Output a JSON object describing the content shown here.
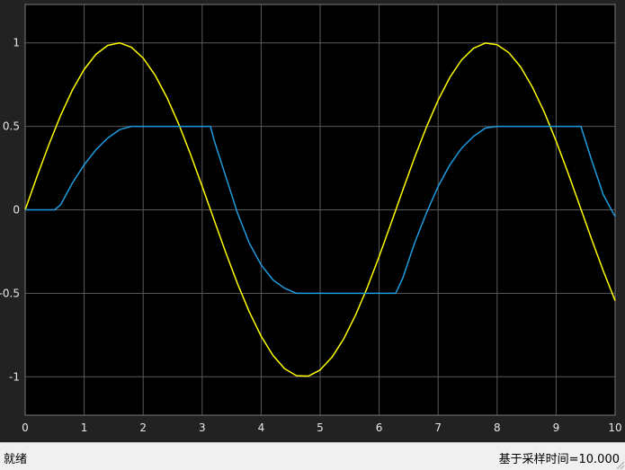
{
  "status_bar": {
    "status_text": "就绪",
    "sample_time_text": "基于采样时间=10.000"
  },
  "colors": {
    "plot_background": "#000000",
    "frame_background": "#222222",
    "grid": "#5a5a5a",
    "series_1": "#ffff00",
    "series_2": "#1f9bde"
  },
  "chart_data": {
    "type": "line",
    "title": "",
    "xlabel": "",
    "ylabel": "",
    "xlim": [
      0,
      10
    ],
    "ylim": [
      -1.23,
      1.23
    ],
    "grid": true,
    "legend": "none",
    "x_ticks": [
      0,
      1,
      2,
      3,
      4,
      5,
      6,
      7,
      8,
      9,
      10
    ],
    "x_tick_labels": [
      "0",
      "1",
      "2",
      "3",
      "4",
      "5",
      "6",
      "7",
      "8",
      "9",
      "10"
    ],
    "y_ticks": [
      1,
      0.5,
      0,
      -0.5,
      -1
    ],
    "y_tick_labels": [
      "1",
      "0.5",
      "0",
      "-0.5",
      "-1"
    ],
    "series": [
      {
        "color": "#ffff00",
        "x": [
          0,
          0.2,
          0.4,
          0.6,
          0.8,
          1.0,
          1.2,
          1.4,
          1.6,
          1.8,
          2.0,
          2.2,
          2.4,
          2.6,
          2.8,
          3.0,
          3.2,
          3.4,
          3.6,
          3.8,
          4.0,
          4.2,
          4.4,
          4.6,
          4.8,
          5.0,
          5.2,
          5.4,
          5.6,
          5.8,
          6.0,
          6.2,
          6.4,
          6.6,
          6.8,
          7.0,
          7.2,
          7.4,
          7.6,
          7.8,
          8.0,
          8.2,
          8.4,
          8.6,
          8.8,
          9.0,
          9.2,
          9.4,
          9.6,
          9.8,
          10.0
        ],
        "y": [
          0,
          0.199,
          0.389,
          0.565,
          0.717,
          0.841,
          0.932,
          0.985,
          1.0,
          0.974,
          0.909,
          0.808,
          0.675,
          0.516,
          0.335,
          0.141,
          -0.058,
          -0.256,
          -0.443,
          -0.612,
          -0.757,
          -0.872,
          -0.952,
          -0.994,
          -0.996,
          -0.959,
          -0.883,
          -0.773,
          -0.631,
          -0.465,
          -0.279,
          -0.083,
          0.117,
          0.312,
          0.494,
          0.657,
          0.794,
          0.899,
          0.968,
          0.999,
          0.989,
          0.941,
          0.855,
          0.734,
          0.585,
          0.412,
          0.223,
          0.025,
          -0.174,
          -0.366,
          -0.544
        ]
      },
      {
        "color": "#1f9bde",
        "x": [
          0,
          0.2,
          0.4,
          0.5,
          0.6,
          0.8,
          1.0,
          1.2,
          1.4,
          1.6,
          1.8,
          2.0,
          2.2,
          2.4,
          2.6,
          2.8,
          3.0,
          3.14,
          3.2,
          3.4,
          3.6,
          3.8,
          4.0,
          4.2,
          4.4,
          4.6,
          4.8,
          5.0,
          5.2,
          5.4,
          5.6,
          5.8,
          6.0,
          6.2,
          6.28,
          6.4,
          6.6,
          6.8,
          7.0,
          7.2,
          7.4,
          7.6,
          7.8,
          8.0,
          8.2,
          8.4,
          8.6,
          8.8,
          9.0,
          9.2,
          9.42,
          9.6,
          9.8,
          10.0
        ],
        "y": [
          0,
          0,
          0,
          0,
          0.03,
          0.16,
          0.27,
          0.36,
          0.43,
          0.48,
          0.5,
          0.5,
          0.5,
          0.5,
          0.5,
          0.5,
          0.5,
          0.5,
          0.42,
          0.2,
          -0.02,
          -0.2,
          -0.33,
          -0.42,
          -0.47,
          -0.5,
          -0.5,
          -0.5,
          -0.5,
          -0.5,
          -0.5,
          -0.5,
          -0.5,
          -0.5,
          -0.5,
          -0.41,
          -0.2,
          -0.02,
          0.14,
          0.27,
          0.37,
          0.44,
          0.49,
          0.5,
          0.5,
          0.5,
          0.5,
          0.5,
          0.5,
          0.5,
          0.5,
          0.3,
          0.09,
          -0.04
        ]
      }
    ]
  }
}
